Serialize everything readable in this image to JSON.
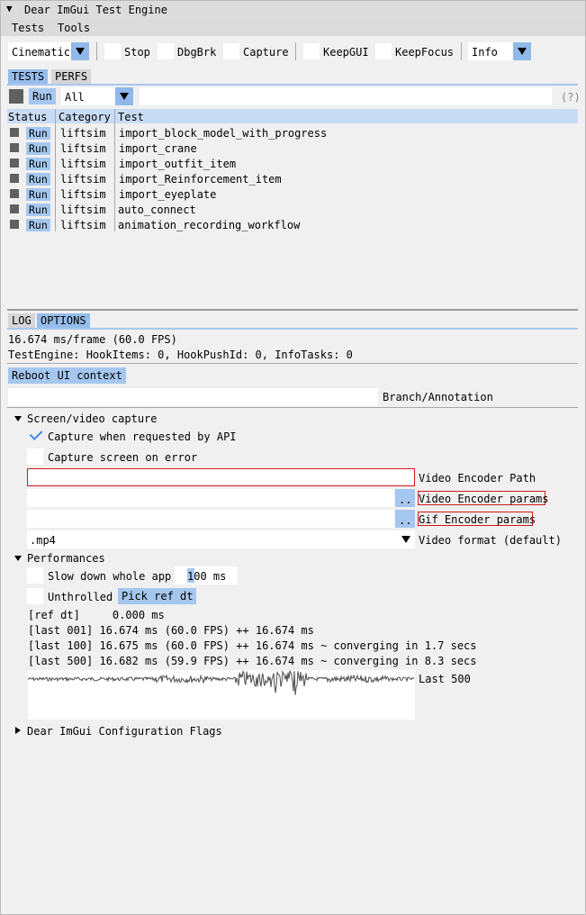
{
  "window": {
    "title": "Dear ImGui Test Engine"
  },
  "menu": [
    "Tests",
    "Tools"
  ],
  "toolbar": {
    "mode_value": "Cinematic",
    "stop": "Stop",
    "dbgbrk": "DbgBrk",
    "capture": "Capture",
    "keepgui": "KeepGUI",
    "keepfocus": "KeepFocus",
    "verbosity_value": "Info"
  },
  "top_tabs": [
    "TESTS",
    "PERFS"
  ],
  "tests_panel": {
    "run_all": "Run",
    "filter_value": "All",
    "help": "(?)",
    "columns": [
      "Status",
      "Category",
      "Test"
    ],
    "run_label": "Run",
    "rows": [
      {
        "category": "liftsim",
        "test": "import_block_model_with_progress"
      },
      {
        "category": "liftsim",
        "test": "import_crane"
      },
      {
        "category": "liftsim",
        "test": "import_outfit_item"
      },
      {
        "category": "liftsim",
        "test": "import_Reinforcement_item"
      },
      {
        "category": "liftsim",
        "test": "import_eyeplate"
      },
      {
        "category": "liftsim",
        "test": "auto_connect"
      },
      {
        "category": "liftsim",
        "test": "animation_recording_workflow"
      }
    ]
  },
  "bottom_tabs": [
    "LOG",
    "OPTIONS"
  ],
  "options": {
    "frame_stats": "16.674 ms/frame (60.0 FPS)",
    "engine_stats": "TestEngine: HookItems: 0, HookPushId: 0, InfoTasks: 0",
    "reboot": "Reboot UI context",
    "branch_label": "Branch/Annotation",
    "capture_section": "Screen/video capture",
    "capture_api": "Capture when requested by API",
    "capture_error": "Capture screen on error",
    "encoder_path_label": "Video Encoder Path",
    "encoder_params_label": "Video Encoder params",
    "gif_params_label": "Gif Encoder params",
    "browse": "..",
    "video_format_value": ".mp4",
    "video_format_label": "Video format (default)",
    "perf_section": "Performances",
    "slow_down": "Slow down whole app",
    "slow_value": "100 ms",
    "unthrolled": "Unthrolled",
    "pick_ref": "Pick ref dt",
    "ref_dt": "[ref dt]     0.000 ms",
    "last001": "[last 001] 16.674 ms (60.0 FPS) ++ 16.674 ms",
    "last100": "[last 100] 16.675 ms (60.0 FPS) ++ 16.674 ms ~ converging in 1.7 secs",
    "last500": "[last 500] 16.682 ms (59.9 FPS) ++ 16.674 ms ~ converging in 8.3 secs",
    "plot_label": "Last 500",
    "config_flags": "Dear ImGui Configuration Flags"
  },
  "colors": {
    "accent": "#96bdeb",
    "error": "#d01818",
    "checkmark": "#3d8be0"
  }
}
